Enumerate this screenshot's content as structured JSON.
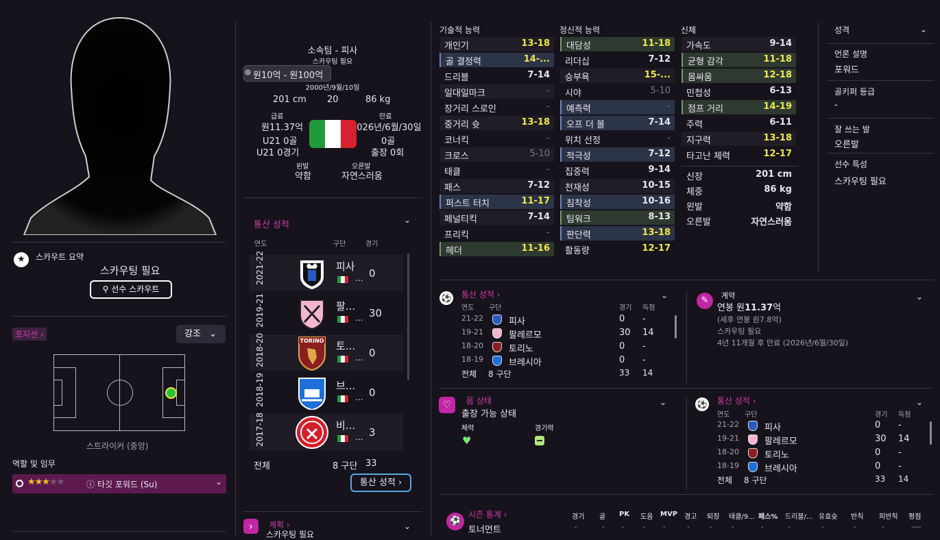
{
  "left": {
    "scout_summary_label": "스카우트 요약",
    "scout_needed": "스카우팅 필요",
    "scout_button": "선수 스카우트",
    "position_tag": "포지션",
    "emphasis_dropdown": "강조",
    "position_name": "스트라이커 (중앙)",
    "roles_label": "역할 및 임무",
    "role_stars": 3,
    "role_stars_max": 5,
    "role_name": "타깃 포워드 (Su)"
  },
  "header": {
    "club_line": "소속팀 - 피사",
    "scout_needed": "스카우팅 필요",
    "value_range": "원10억 - 원100억",
    "dob": "2000년/9월/10일",
    "height": "201 cm",
    "age": "20",
    "weight": "86 kg",
    "wage_label": "급료",
    "wage": "원11.37억",
    "expires_label": "만료",
    "expires": "2026년/6월/30일",
    "u21_goals": "U21 0골",
    "u21_apps": "U21 0경기",
    "goals": "0골",
    "apps": "출장 0회",
    "left_foot_label": "왼발",
    "left_foot": "약함",
    "right_foot_label": "오른발",
    "right_foot": "자연스러움",
    "flag_colors": [
      "#1f9a3a",
      "#ffffff",
      "#d8212e"
    ]
  },
  "career": {
    "title": "통산 성적",
    "col_year": "연도",
    "col_club": "구단",
    "col_apps": "경기",
    "rows": [
      {
        "year": "2021-22",
        "club": "피사",
        "apps": "0"
      },
      {
        "year": "2019-21",
        "club": "팔...",
        "apps": "30"
      },
      {
        "year": "2018-20",
        "club": "토...",
        "apps": "0"
      },
      {
        "year": "2018-19",
        "club": "브...",
        "apps": "0"
      },
      {
        "year": "2017-18",
        "club": "비...",
        "apps": "3"
      }
    ],
    "ellipsis": "...",
    "total_label": "전체",
    "total_clubs": "8 구단",
    "total_apps": "33",
    "button": "통산 성적"
  },
  "plans": {
    "title": "계획",
    "sub": "스카우팅 필요"
  },
  "attributes": {
    "technical_title": "기술적 능력",
    "mental_title": "정신적 능력",
    "physical_title": "신체",
    "technical": [
      {
        "name": "개인기",
        "value": "13-18"
      },
      {
        "name": "골 결정력",
        "value": "14-..."
      },
      {
        "name": "드리블",
        "value": "7-14"
      },
      {
        "name": "일대일마크",
        "value": "-"
      },
      {
        "name": "장거리 스로인",
        "value": "-"
      },
      {
        "name": "중거리 슛",
        "value": "13-18"
      },
      {
        "name": "코너킥",
        "value": "-"
      },
      {
        "name": "크로스",
        "value": "5-10"
      },
      {
        "name": "태클",
        "value": "-"
      },
      {
        "name": "패스",
        "value": "7-12"
      },
      {
        "name": "퍼스트 터치",
        "value": "11-17"
      },
      {
        "name": "페널티킥",
        "value": "7-14"
      },
      {
        "name": "프리킥",
        "value": "-"
      },
      {
        "name": "헤더",
        "value": "11-16"
      }
    ],
    "mental": [
      {
        "name": "대담성",
        "value": "11-18"
      },
      {
        "name": "리더십",
        "value": "7-12"
      },
      {
        "name": "승부욕",
        "value": "15-..."
      },
      {
        "name": "시야",
        "value": "5-10"
      },
      {
        "name": "예측력",
        "value": "-"
      },
      {
        "name": "오프 더 볼",
        "value": "7-14"
      },
      {
        "name": "위치 선정",
        "value": "-"
      },
      {
        "name": "적극성",
        "value": "7-12"
      },
      {
        "name": "집중력",
        "value": "9-14"
      },
      {
        "name": "천재성",
        "value": "10-15"
      },
      {
        "name": "침착성",
        "value": "10-16"
      },
      {
        "name": "팀워크",
        "value": "8-13"
      },
      {
        "name": "판단력",
        "value": "13-18"
      },
      {
        "name": "활동량",
        "value": "12-17"
      }
    ],
    "physical": [
      {
        "name": "가속도",
        "value": "9-14"
      },
      {
        "name": "균형 감각",
        "value": "11-18"
      },
      {
        "name": "몸싸움",
        "value": "12-18"
      },
      {
        "name": "민첩성",
        "value": "6-13"
      },
      {
        "name": "점프 거리",
        "value": "14-19"
      },
      {
        "name": "주력",
        "value": "6-11"
      },
      {
        "name": "지구력",
        "value": "13-18"
      },
      {
        "name": "타고난 체력",
        "value": "12-17"
      }
    ],
    "physical_extra": [
      {
        "name": "신장",
        "value": "201 cm"
      },
      {
        "name": "체중",
        "value": "86 kg"
      },
      {
        "name": "왼발",
        "value": "약함"
      },
      {
        "name": "오른발",
        "value": "자연스러움"
      }
    ]
  },
  "personality": {
    "title": "성격",
    "media_label": "언론 설명",
    "media_value": "포워드",
    "gk_label": "골키퍼 등급",
    "gk_value": "-",
    "foot_label": "잘 쓰는 발",
    "foot_value": "오른발",
    "traits_label": "선수 특성",
    "traits_value": "스카우팅 필요"
  },
  "career_small": {
    "title": "통산 성적",
    "col_year": "연도",
    "col_club": "구단",
    "col_apps": "경기",
    "col_goals": "득점",
    "rows": [
      {
        "year": "21-22",
        "club": "피사",
        "apps": "0",
        "goals": "-"
      },
      {
        "year": "19-21",
        "club": "팔레르모",
        "apps": "30",
        "goals": "14"
      },
      {
        "year": "18-20",
        "club": "토리노",
        "apps": "0",
        "goals": "-"
      },
      {
        "year": "18-19",
        "club": "브레시아",
        "apps": "0",
        "goals": "-"
      }
    ],
    "total_label": "전체",
    "total_clubs": "8 구단",
    "total_apps": "33",
    "total_goals": "14"
  },
  "contract": {
    "title": "계약",
    "wage_prefix": "연봉 원",
    "wage_value": "11.37",
    "wage_suffix": "억",
    "after_tax": "(세후 연봉 원7.8억)",
    "scout_needed": "스카우팅 필요",
    "expiry": "4년 11개월 후 만료 (2026년/6월/30일)"
  },
  "condition": {
    "title": "몸 상태",
    "status": "출장 가능 상태",
    "stamina_label": "체력",
    "sharpness_label": "경기력"
  },
  "season": {
    "title": "시즌 통계",
    "columns": [
      "경기",
      "골",
      "PK",
      "도움",
      "MVP",
      "경고",
      "퇴장",
      "태클/9...",
      "패스%",
      "드리블/...",
      "유효슛",
      "반칙",
      "피반칙",
      "평점"
    ],
    "row_label": "토너먼트",
    "row_values": [
      "-",
      "-",
      "-",
      "-",
      "-",
      "-",
      "-",
      "-",
      "-",
      "-",
      "-",
      "-",
      "-",
      "----"
    ]
  },
  "colors": {
    "accent": "#d23ca9",
    "highlight_yellow": "#f0e84a",
    "bg": "#16131c"
  }
}
